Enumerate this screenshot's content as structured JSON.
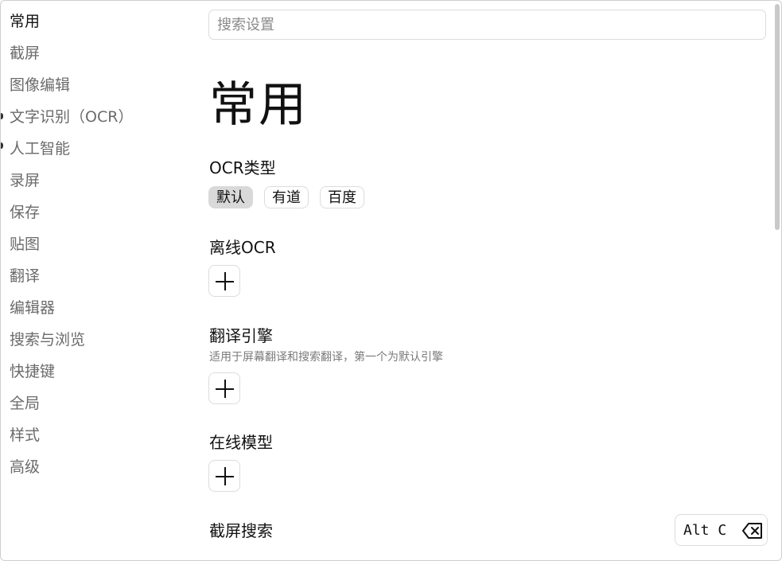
{
  "sidebar": {
    "items": [
      {
        "label": "常用",
        "active": true
      },
      {
        "label": "截屏"
      },
      {
        "label": "图像编辑"
      },
      {
        "label": "文字识别（OCR）"
      },
      {
        "label": "人工智能"
      },
      {
        "label": "录屏"
      },
      {
        "label": "保存"
      },
      {
        "label": "贴图"
      },
      {
        "label": "翻译"
      },
      {
        "label": "编辑器"
      },
      {
        "label": "搜索与浏览"
      },
      {
        "label": "快捷键"
      },
      {
        "label": "全局"
      },
      {
        "label": "样式"
      },
      {
        "label": "高级"
      }
    ]
  },
  "search": {
    "placeholder": "搜索设置",
    "value": ""
  },
  "page": {
    "title": "常用"
  },
  "sections": {
    "ocr_type": {
      "title": "OCR类型",
      "options": [
        "默认",
        "有道",
        "百度"
      ],
      "selected": "默认"
    },
    "offline_ocr": {
      "title": "离线OCR"
    },
    "translate_engine": {
      "title": "翻译引擎",
      "desc": "适用于屏幕翻译和搜索翻译，第一个为默认引擎"
    },
    "online_model": {
      "title": "在线模型"
    },
    "screenshot_search": {
      "title": "截屏搜索",
      "shortcut": "Alt C"
    }
  },
  "icons": {
    "add": "plus-icon",
    "clear": "backspace-icon"
  },
  "colors": {
    "selected_chip": "#d9d9d9",
    "muted_text": "#6b6b6b",
    "border": "#dcdcdc"
  }
}
